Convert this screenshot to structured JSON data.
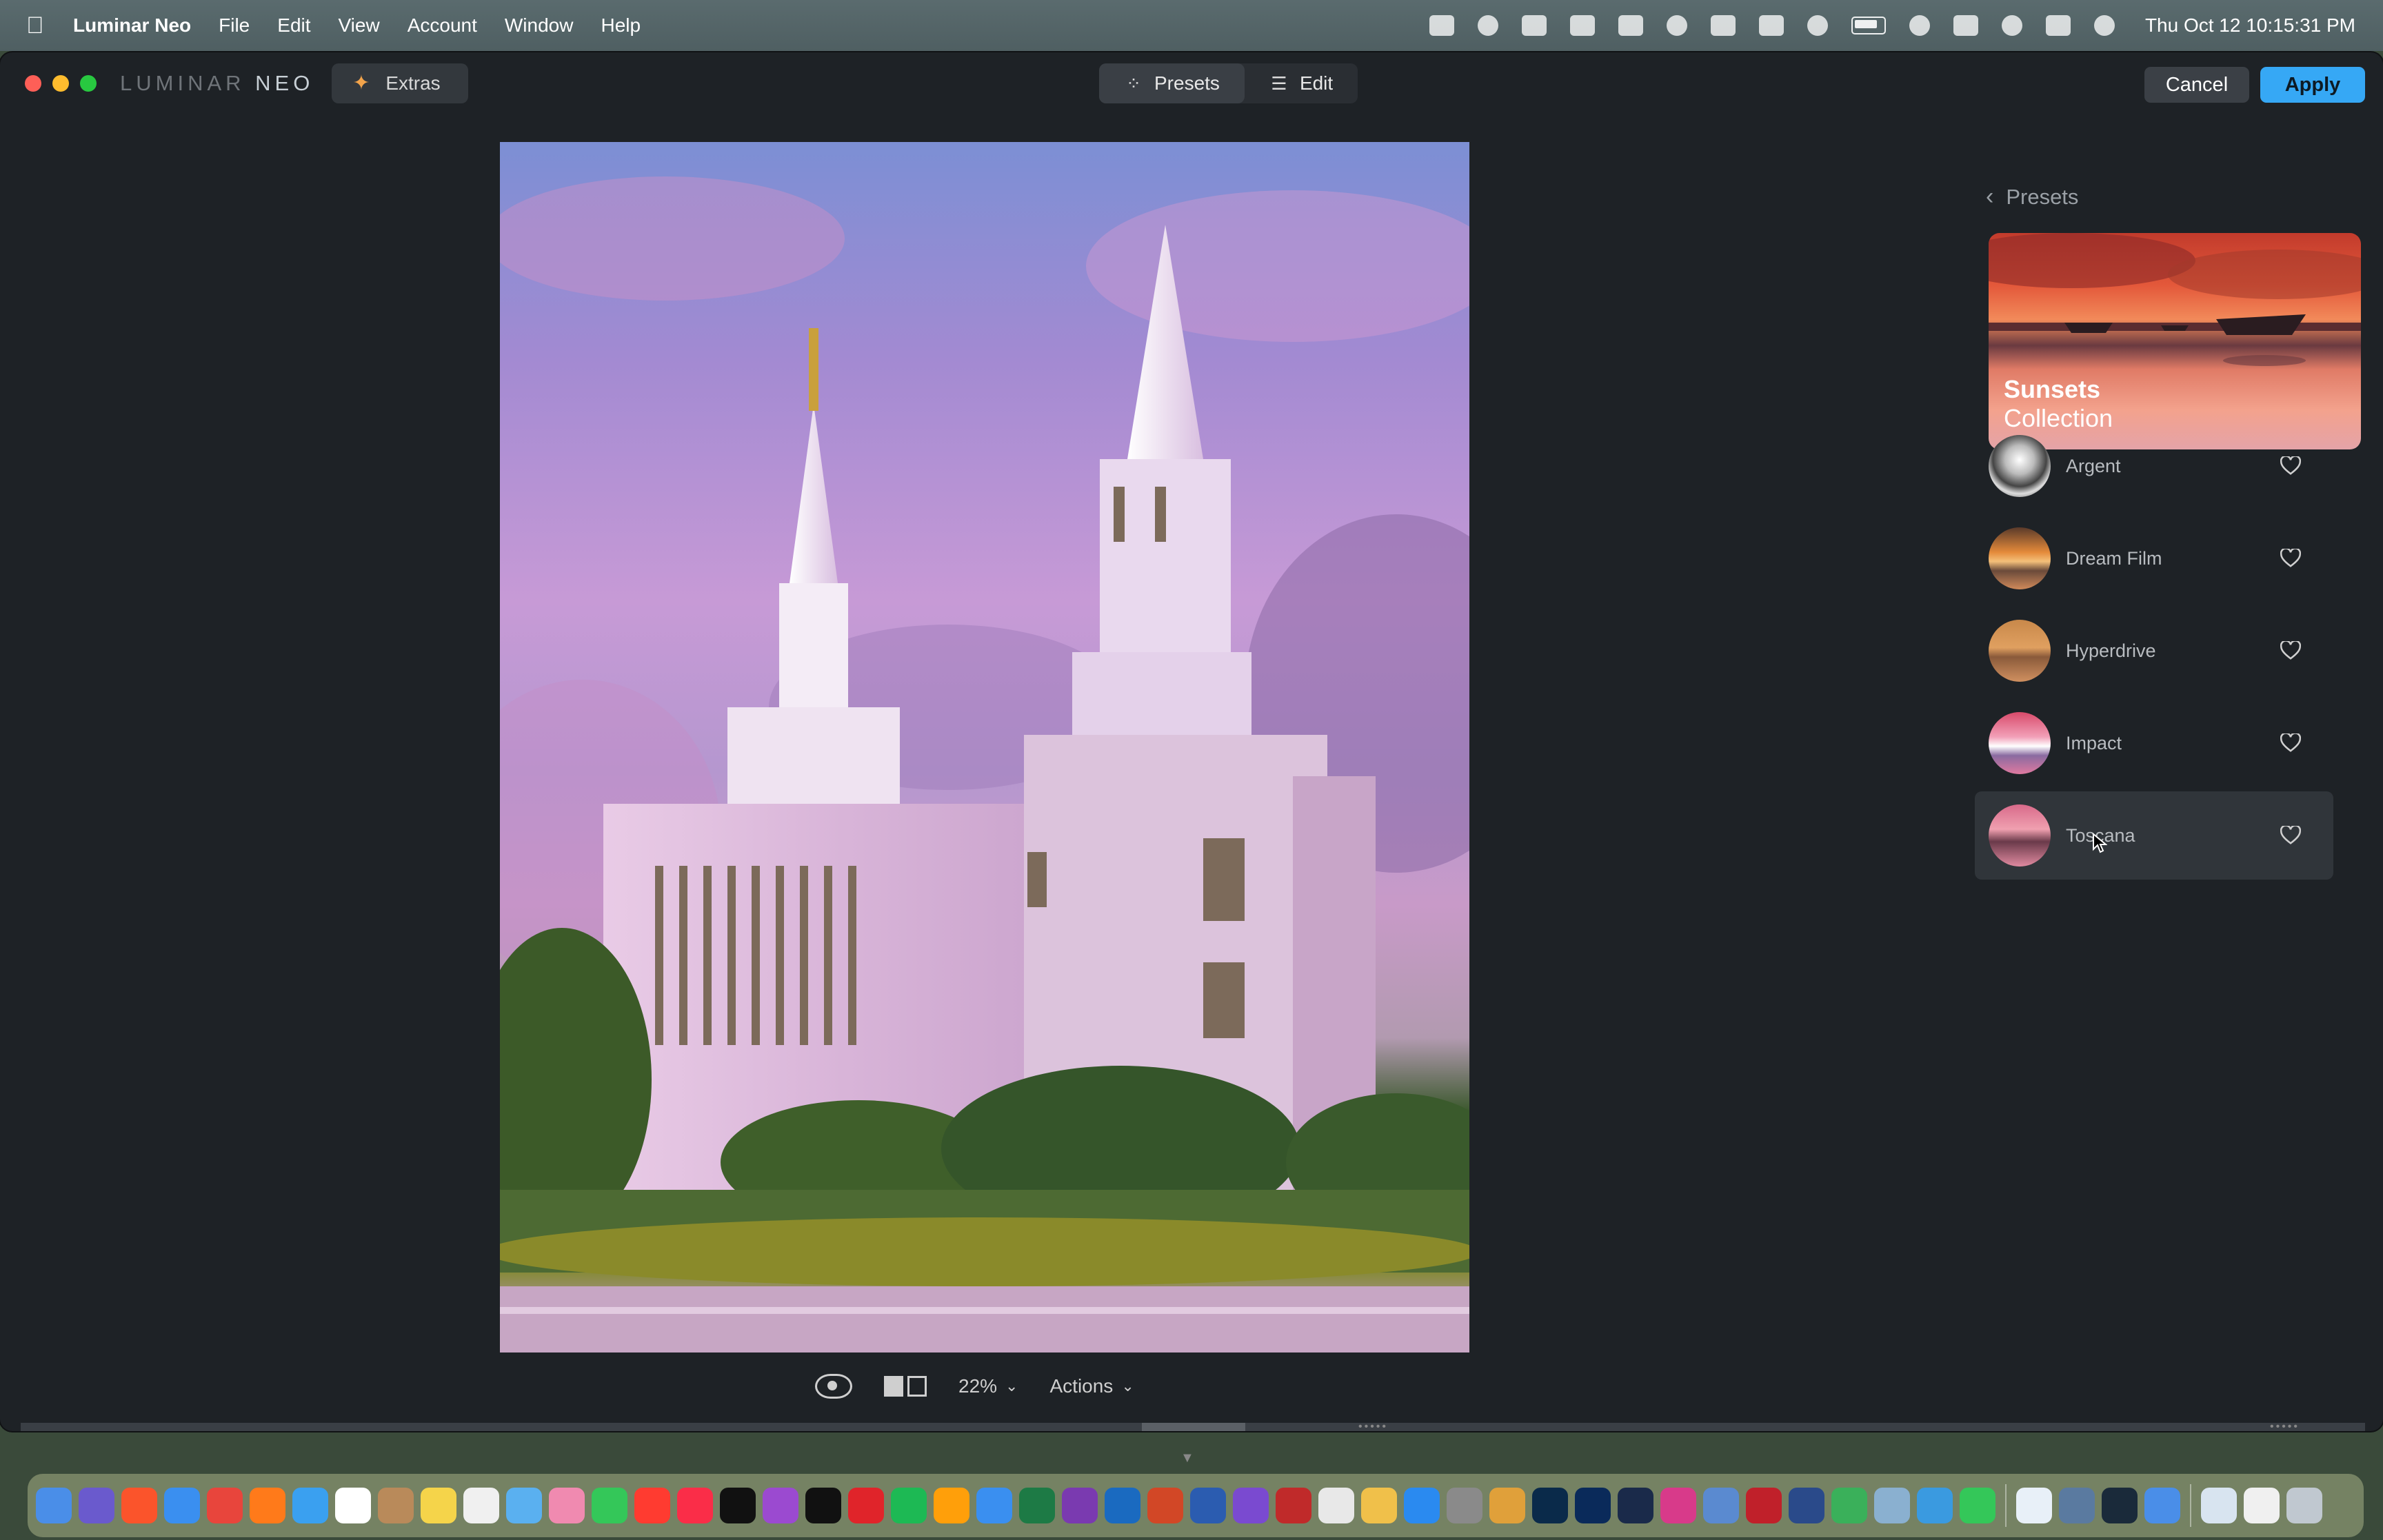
{
  "menubar": {
    "apple_icon": "apple-logo-icon",
    "app_name": "Luminar Neo",
    "items": [
      "File",
      "Edit",
      "View",
      "Account",
      "Window",
      "Help"
    ],
    "clock": "Thu Oct 12  10:15:31 PM"
  },
  "window": {
    "brand_left": "LUMINAR",
    "brand_right": "NEO",
    "extras_label": "Extras",
    "tabs": [
      {
        "label": "Presets",
        "icon": "sparkle-icon",
        "active": true
      },
      {
        "label": "Edit",
        "icon": "sliders-icon",
        "active": false
      }
    ],
    "cancel_label": "Cancel",
    "apply_label": "Apply"
  },
  "bottom_toolbar": {
    "zoom": "22%",
    "actions": "Actions"
  },
  "presets_panel": {
    "back_label": "Presets",
    "collection": {
      "title": "Sunsets",
      "subtitle": "Collection"
    },
    "items": [
      {
        "name": "Argent"
      },
      {
        "name": "Dream Film"
      },
      {
        "name": "Hyperdrive"
      },
      {
        "name": "Impact"
      },
      {
        "name": "Toscana"
      }
    ]
  },
  "colors": {
    "apply": "#36a8f5",
    "window_bg": "#1e2226",
    "extras_icon": "#f3a44b"
  }
}
